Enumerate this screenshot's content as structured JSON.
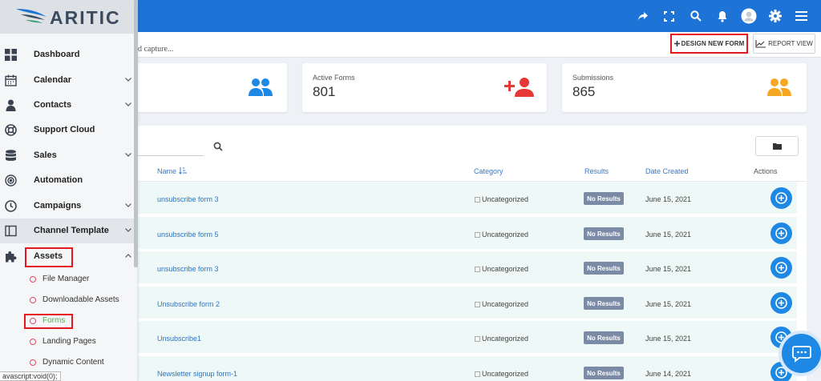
{
  "app": {
    "logo": "ARITIC"
  },
  "subheader": {
    "breadcrumb": "d capture...",
    "design_button": "DESIGN NEW FORM",
    "report_button": "REPORT VIEW"
  },
  "stats": [
    {
      "label": "",
      "value": "",
      "color": "#1e88e5"
    },
    {
      "label": "Active Forms",
      "value": "801",
      "color": "#e53935"
    },
    {
      "label": "Submissions",
      "value": "865",
      "color": "#f5a623"
    }
  ],
  "table": {
    "headers": {
      "name": "Name",
      "category": "Category",
      "results": "Results",
      "date": "Date Created",
      "actions": "Actions"
    },
    "rows": [
      {
        "name": "unsubscribe form 3",
        "category": "Uncategorized",
        "results": "No Results",
        "date": "June 15, 2021"
      },
      {
        "name": "unsubscribe form 5",
        "category": "Uncategorized",
        "results": "No Results",
        "date": "June 15, 2021"
      },
      {
        "name": "unsubscribe form 3",
        "category": "Uncategorized",
        "results": "No Results",
        "date": "June 15, 2021"
      },
      {
        "name": "Unsubscribe form 2",
        "category": "Uncategorized",
        "results": "No Results",
        "date": "June 15, 2021"
      },
      {
        "name": "Unsubscribe1",
        "category": "Uncategorized",
        "results": "No Results",
        "date": "June 15, 2021"
      },
      {
        "name": "Newsletter signup form-1",
        "category": "Uncategorized",
        "results": "No Results",
        "date": "June 14, 2021"
      }
    ]
  },
  "sidebar": {
    "items": [
      {
        "label": "Dashboard",
        "icon": "dashboard-icon"
      },
      {
        "label": "Calendar",
        "icon": "calendar-icon"
      },
      {
        "label": "Contacts",
        "icon": "user-icon"
      },
      {
        "label": "Support Cloud",
        "icon": "lifebuoy-icon"
      },
      {
        "label": "Sales",
        "icon": "database-icon"
      },
      {
        "label": "Automation",
        "icon": "target-icon"
      },
      {
        "label": "Campaigns",
        "icon": "clock-icon"
      },
      {
        "label": "Channel Template",
        "icon": "columns-icon"
      },
      {
        "label": "Assets",
        "icon": "puzzle-icon"
      }
    ],
    "sub_items": [
      {
        "label": "File Manager"
      },
      {
        "label": "Downloadable Assets"
      },
      {
        "label": "Forms"
      },
      {
        "label": "Landing Pages"
      },
      {
        "label": "Dynamic Content"
      }
    ]
  },
  "status_bar": "avascript:void(0);",
  "colors": {
    "topbar": "#1e73d6",
    "accent": "#1e88e5",
    "highlight": "#e5161c",
    "active_sub": "#4caf50"
  }
}
